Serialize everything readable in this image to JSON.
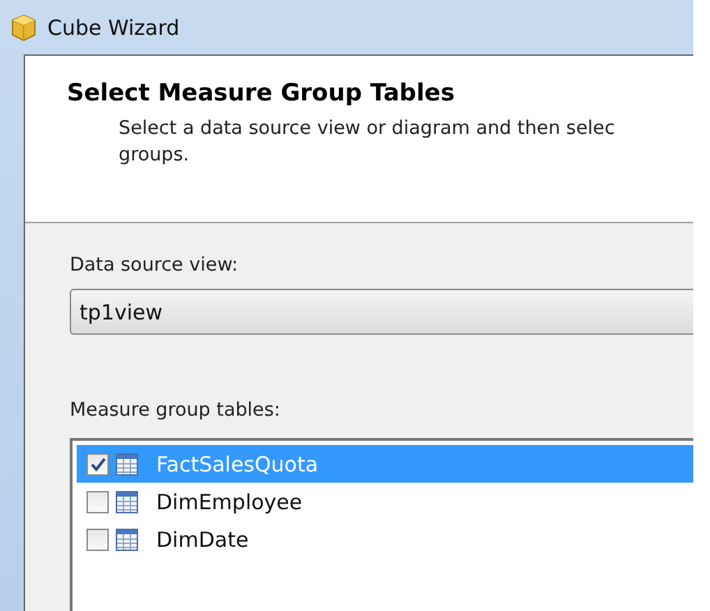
{
  "window": {
    "title": "Cube Wizard"
  },
  "header": {
    "title": "Select Measure Group Tables",
    "description": "Select a data source view or diagram and then selec",
    "description_line_2": "groups."
  },
  "data_source_view": {
    "label": "Data source view:",
    "value": "tp1view"
  },
  "measure_group_tables": {
    "label": "Measure group tables:",
    "items": [
      {
        "name": "FactSalesQuota",
        "checked": true,
        "selected": true
      },
      {
        "name": "DimEmployee",
        "checked": false,
        "selected": false
      },
      {
        "name": "DimDate",
        "checked": false,
        "selected": false
      }
    ]
  }
}
